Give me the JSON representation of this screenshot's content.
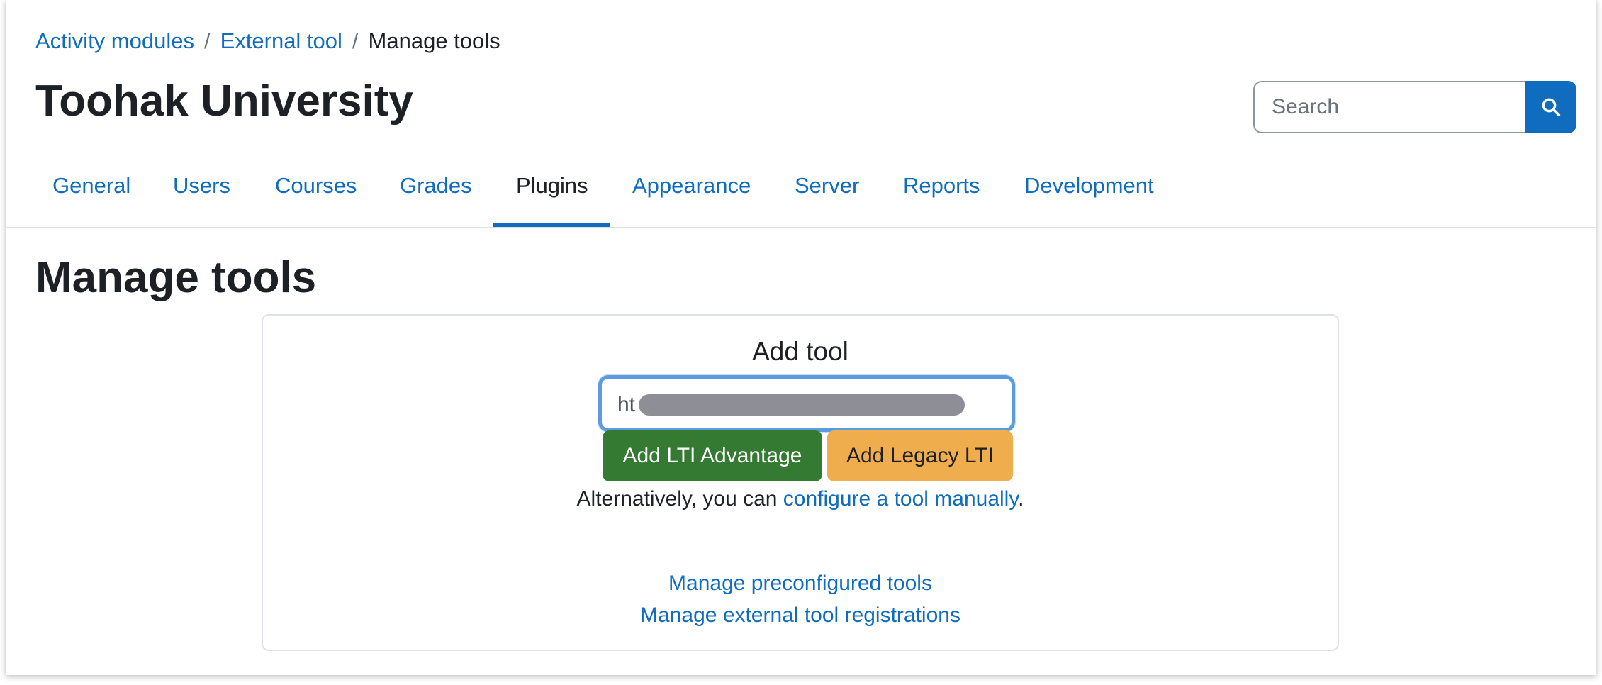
{
  "breadcrumb": {
    "items": [
      "Activity modules",
      "External tool"
    ],
    "current": "Manage tools",
    "separator": "/"
  },
  "header": {
    "site_title": "Toohak University",
    "search_placeholder": "Search",
    "search_icon": "search-icon"
  },
  "nav": {
    "tabs": [
      {
        "label": "General",
        "active": false
      },
      {
        "label": "Users",
        "active": false
      },
      {
        "label": "Courses",
        "active": false
      },
      {
        "label": "Grades",
        "active": false
      },
      {
        "label": "Plugins",
        "active": true
      },
      {
        "label": "Appearance",
        "active": false
      },
      {
        "label": "Server",
        "active": false
      },
      {
        "label": "Reports",
        "active": false
      },
      {
        "label": "Development",
        "active": false
      }
    ]
  },
  "main": {
    "page_title": "Manage tools",
    "add_tool": {
      "title": "Add tool",
      "url_value": "ht",
      "add_lti_advantage_label": "Add LTI Advantage",
      "add_legacy_lti_label": "Add Legacy LTI",
      "alternative_prefix": "Alternatively, you can ",
      "configure_manually_link": "configure a tool manually",
      "alternative_suffix": "."
    },
    "links": {
      "preconfigured": "Manage preconfigured tools",
      "registrations": "Manage external tool registrations"
    }
  },
  "colors": {
    "link": "#0f6cbf",
    "primary": "#0f6cbf",
    "success": "#357a32",
    "warning": "#f0ad4e",
    "focus_ring": "#5b9be0"
  }
}
